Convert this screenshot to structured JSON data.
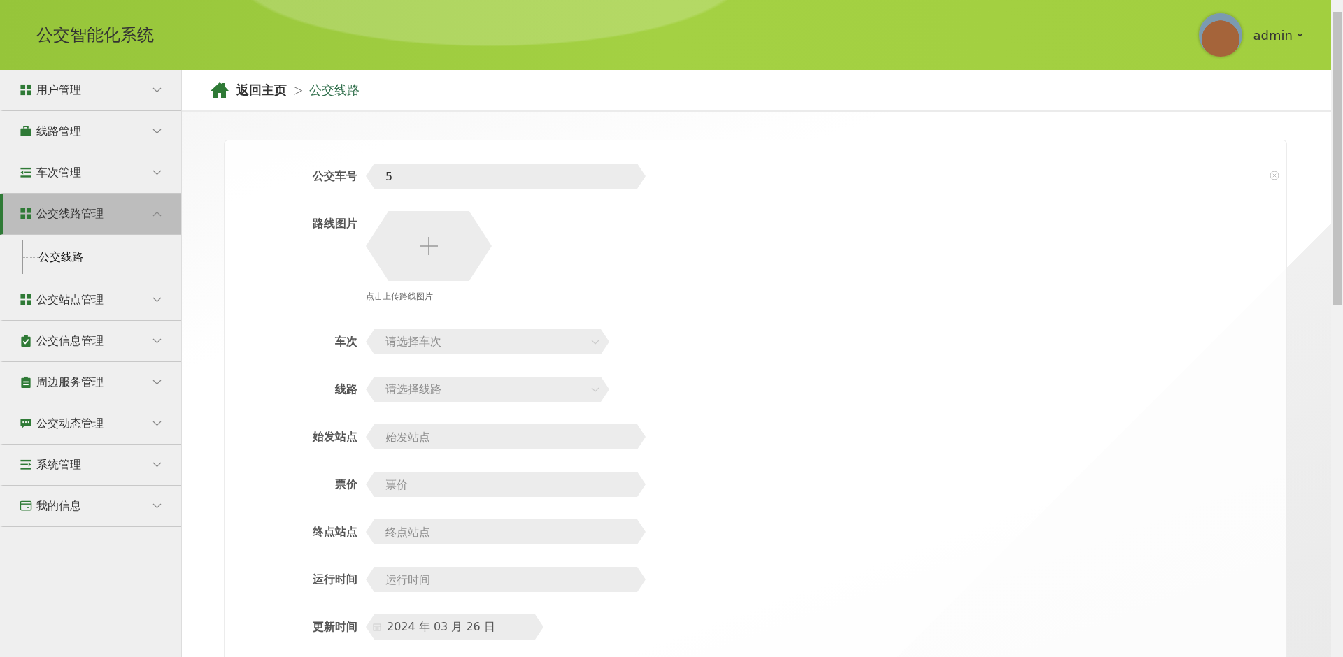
{
  "header": {
    "title": "公交智能化系统",
    "user": "admin"
  },
  "sidebar": {
    "items": [
      {
        "label": "用户管理",
        "expanded": false
      },
      {
        "label": "线路管理",
        "expanded": false
      },
      {
        "label": "车次管理",
        "expanded": false
      },
      {
        "label": "公交线路管理",
        "expanded": true,
        "children": [
          {
            "label": "公交线路"
          }
        ]
      },
      {
        "label": "公交站点管理",
        "expanded": false
      },
      {
        "label": "公交信息管理",
        "expanded": false
      },
      {
        "label": "周边服务管理",
        "expanded": false
      },
      {
        "label": "公交动态管理",
        "expanded": false
      },
      {
        "label": "系统管理",
        "expanded": false
      },
      {
        "label": "我的信息",
        "expanded": false
      }
    ]
  },
  "breadcrumb": {
    "home": "返回主页",
    "separator": "▷",
    "current": "公交线路"
  },
  "form": {
    "fields": [
      {
        "kind": "text",
        "label": "公交车号",
        "value": "5"
      },
      {
        "kind": "upload",
        "label": "路线图片",
        "hint": "点击上传路线图片"
      },
      {
        "kind": "select",
        "label": "车次",
        "placeholder": "请选择车次"
      },
      {
        "kind": "select",
        "label": "线路",
        "placeholder": "请选择线路"
      },
      {
        "kind": "text",
        "label": "始发站点",
        "placeholder": "始发站点"
      },
      {
        "kind": "text",
        "label": "票价",
        "placeholder": "票价"
      },
      {
        "kind": "text",
        "label": "终点站点",
        "placeholder": "终点站点"
      },
      {
        "kind": "text",
        "label": "运行时间",
        "placeholder": "运行时间"
      },
      {
        "kind": "date",
        "label": "更新时间",
        "value": "2024 年 03 月 26 日"
      }
    ]
  }
}
